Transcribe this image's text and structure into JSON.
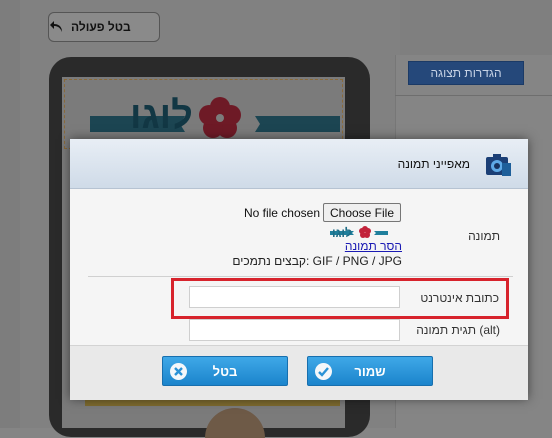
{
  "toolbar": {
    "undo_label": "בטל פעולה"
  },
  "side_panel": {
    "preview_settings_label": "הגדרות תצוגה"
  },
  "brand": {
    "logo_text": "לוגו",
    "accent_color": "#1f7f9c",
    "flower_color": "#c2233b"
  },
  "dialog": {
    "title": "מאפייני תמונה",
    "image_label": "תמונה",
    "file_status": "No file chosen",
    "choose_file_label": "Choose File",
    "remove_image_label": "הסר תמונה",
    "file_types": "קבצים נתמכים: GIF / PNG / JPG",
    "url_label": "כתובת אינטרנט",
    "url_value": "",
    "alt_label": "תגית תמונה (alt)",
    "alt_value": "",
    "save_label": "שמור",
    "cancel_label": "בטל"
  },
  "colors": {
    "highlight": "#d7232c",
    "button": "#2a92d6"
  }
}
